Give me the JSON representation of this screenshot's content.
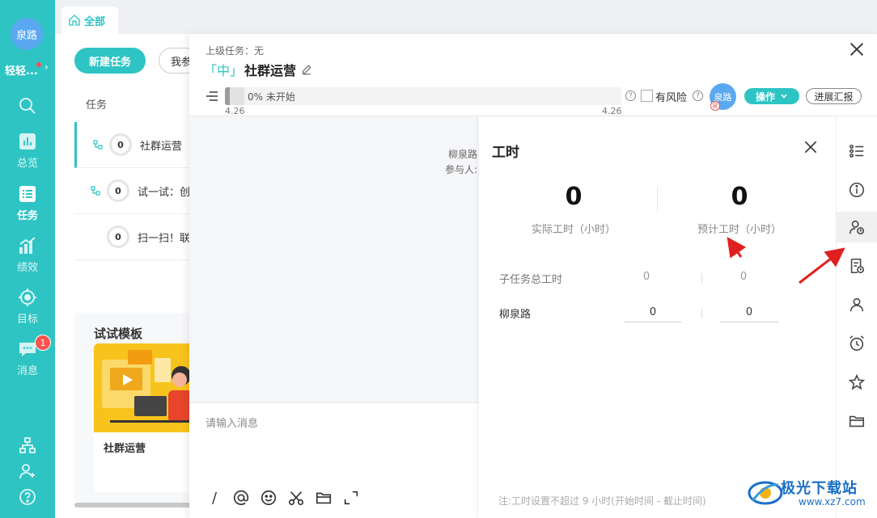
{
  "sidebar": {
    "avatar_text": "泉路",
    "user_name": "轻轻...",
    "nav": [
      {
        "label": "总览"
      },
      {
        "label": "任务"
      },
      {
        "label": "绩效"
      },
      {
        "label": "目标"
      },
      {
        "label": "消息"
      }
    ],
    "message_badge": "1"
  },
  "tab": {
    "label": "全部"
  },
  "task_list": {
    "new_task_label": "新建任务",
    "my_filter_label": "我参",
    "column_header": "任务",
    "rows": [
      {
        "count": "0",
        "name": "社群运营"
      },
      {
        "count": "0",
        "name": "试一试：创"
      },
      {
        "count": "0",
        "name": "扫一扫！联"
      }
    ],
    "templates_title": "试试模板",
    "template_name": "社群运营"
  },
  "detail": {
    "parent_label": "上级任务：无",
    "priority": "「中」",
    "title": "社群运营",
    "progress_text": "0% 未开始",
    "progress_fraction": 0,
    "start_date": "4.26",
    "end_date": "4.26",
    "risk_label": "有风险",
    "assignee_avatar": "泉路",
    "assignee_mini": "泉",
    "actions_label": "操作",
    "report_label": "进展汇报",
    "creator_text": "柳泉路",
    "members_text": "参与人:",
    "input_placeholder": "请输入消息"
  },
  "work_hours": {
    "title": "工时",
    "actual_value": "0",
    "actual_label": "实际工时（小时）",
    "estimated_value": "0",
    "estimated_label": "预计工时（小时）",
    "rows": [
      {
        "label": "子任务总工时",
        "actual": "0",
        "estimated": "0"
      },
      {
        "label": "柳泉路",
        "actual": "0",
        "estimated": "0"
      }
    ],
    "note": "注:工时设置不超过 9 小时(开始时间 - 截止时间)"
  },
  "watermark": {
    "cn": "极光下载站",
    "en": "www.xz7.com"
  },
  "colors": {
    "accent": "#2ec4c4",
    "badge": "#f5544f",
    "avatar": "#5aa9f0",
    "annotation_arrow": "#e02020"
  }
}
